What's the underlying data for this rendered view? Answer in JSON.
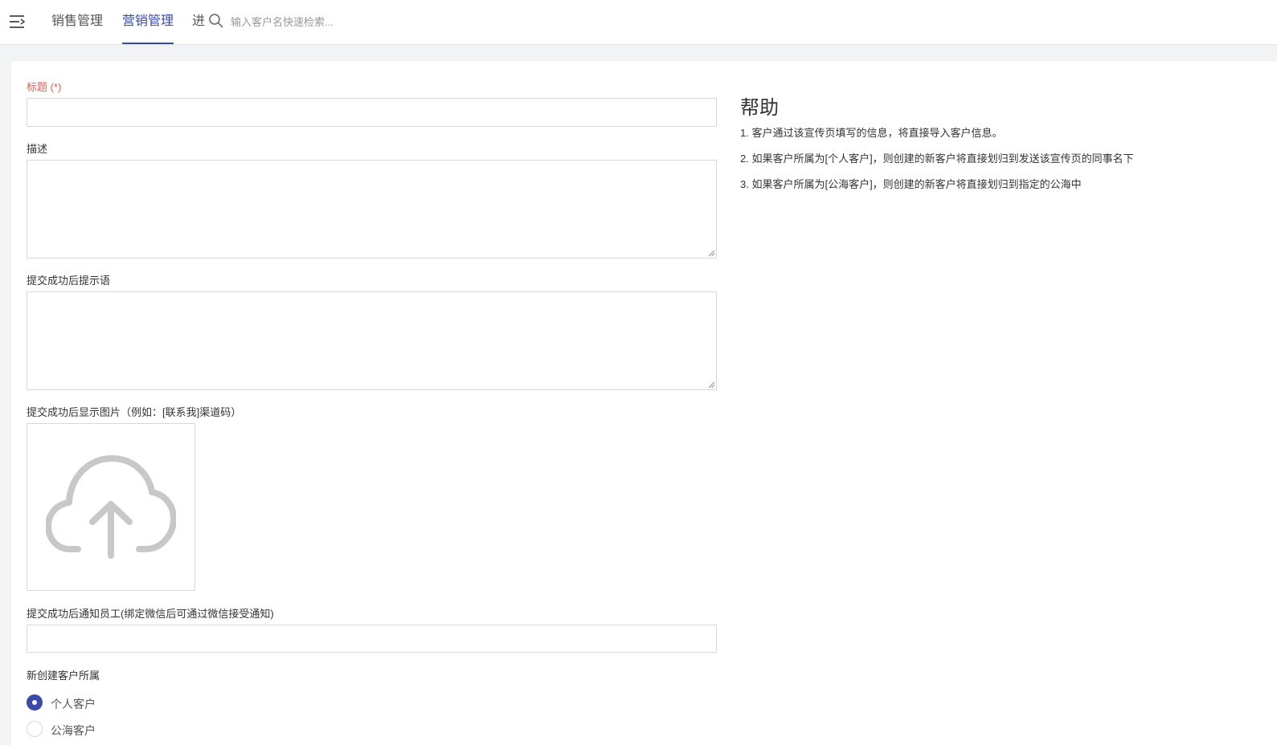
{
  "nav": {
    "tabs": [
      {
        "label": "销售管理",
        "active": false
      },
      {
        "label": "营销管理",
        "active": true
      },
      {
        "label": "进",
        "active": false
      }
    ],
    "search_placeholder": "输入客户名快速检索..."
  },
  "form": {
    "title_label": "标题 (*)",
    "title_value": "",
    "desc_label": "描述",
    "desc_value": "",
    "success_msg_label": "提交成功后提示语",
    "success_msg_value": "",
    "success_image_label": "提交成功后显示图片（例如：[联系我]渠道码）",
    "notify_label": "提交成功后通知员工(绑定微信后可通过微信接受通知)",
    "notify_value": "",
    "owner_label": "新创建客户所属",
    "owner_options": [
      {
        "label": "个人客户",
        "checked": true
      },
      {
        "label": "公海客户",
        "checked": false
      }
    ]
  },
  "help": {
    "title": "帮助",
    "items": [
      "1. 客户通过该宣传页填写的信息，将直接导入客户信息。",
      "2. 如果客户所属为[个人客户]，则创建的新客户将直接划归到发送该宣传页的同事名下",
      "3. 如果客户所属为[公海客户]，则创建的新客户将直接划归到指定的公海中"
    ]
  },
  "colors": {
    "accent": "#3a4aa8",
    "required": "#e0605a",
    "border": "#d6d8dc",
    "background": "#f2f3f5"
  }
}
